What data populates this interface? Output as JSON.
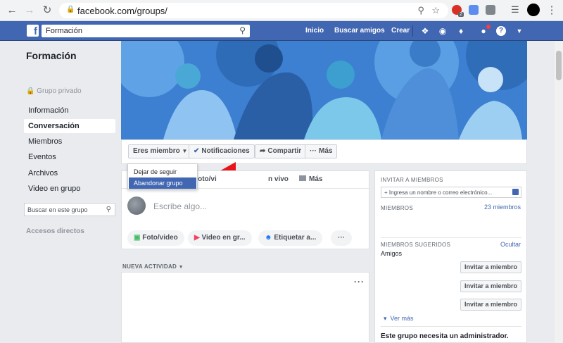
{
  "browser": {
    "url": "facebook.com/groups/",
    "back_icon": "arrow-left-icon",
    "forward_icon": "arrow-right-icon",
    "reload_icon": "reload-icon",
    "ext_badge": "2"
  },
  "fb_header": {
    "search_value": "Formación",
    "nav": [
      "Inicio",
      "Buscar amigos",
      "Crear"
    ],
    "brand_color": "#4267b2"
  },
  "sidebar": {
    "group_title": "Formación",
    "privacy": "Grupo privado",
    "items": [
      {
        "label": "Información"
      },
      {
        "label": "Conversación",
        "active": true
      },
      {
        "label": "Miembros"
      },
      {
        "label": "Eventos"
      },
      {
        "label": "Archivos"
      },
      {
        "label": "Video en grupo"
      }
    ],
    "search_placeholder": "Buscar en este grupo",
    "shortcuts": "Accesos directos"
  },
  "actions": {
    "member": "Eres miembro",
    "notifications": "Notificaciones",
    "share": "Compartir",
    "more": "Más"
  },
  "member_menu": {
    "items": [
      "Dejar de seguir grupo",
      "Abandonar grupo"
    ],
    "highlighted_index": 1
  },
  "composer": {
    "tabs": [
      "Foto/vi",
      "n vivo",
      "Más"
    ],
    "placeholder": "Escribe algo...",
    "pills": [
      "Foto/video",
      "Video en gr...",
      "Etiquetar a..."
    ]
  },
  "feed": {
    "header": "NUEVA ACTIVIDAD"
  },
  "right": {
    "invite_header": "INVITAR A MIEMBROS",
    "invite_placeholder": "+ Ingresa un nombre o correo electrónico...",
    "members_header": "MIEMBROS",
    "members_count": "23 miembros",
    "suggested_header": "MIEMBROS SUGERIDOS",
    "hide": "Ocultar",
    "friends": "Amigos",
    "invite_buttons": [
      "Invitar a miembro",
      "Invitar a miembro",
      "Invitar a miembro"
    ],
    "see_more": "Ver más",
    "admin_notice": "Este grupo necesita un administrador."
  }
}
